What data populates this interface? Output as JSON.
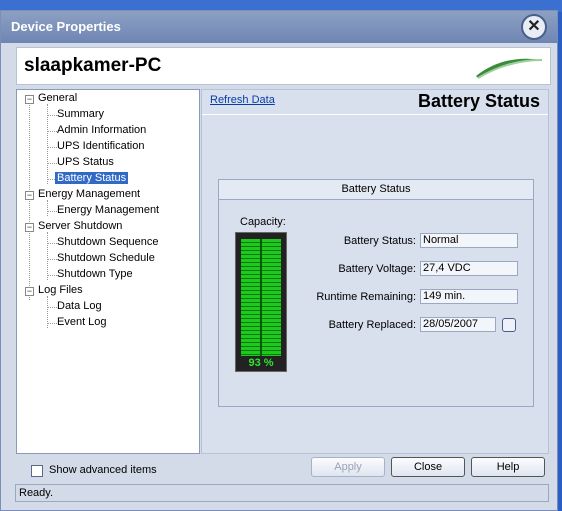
{
  "window": {
    "title": "Device Properties",
    "close_icon": "close-icon"
  },
  "header": {
    "hostname": "slaapkamer-PC",
    "logo_icon": "swoosh-logo-icon"
  },
  "tree": {
    "general": "General",
    "summary": "Summary",
    "admin_info": "Admin Information",
    "ups_id": "UPS Identification",
    "ups_status": "UPS Status",
    "battery_status": "Battery Status",
    "energy_mgmt_group": "Energy Management",
    "energy_mgmt": "Energy Management",
    "server_shutdown": "Server Shutdown",
    "shutdown_sequence": "Shutdown Sequence",
    "shutdown_schedule": "Shutdown Schedule",
    "shutdown_type": "Shutdown Type",
    "log_files": "Log Files",
    "data_log": "Data Log",
    "event_log": "Event Log",
    "expander_symbol": "−"
  },
  "content": {
    "refresh_link": "Refresh Data",
    "heading": "Battery Status",
    "group_title": "Battery Status",
    "capacity_label": "Capacity:",
    "capacity_value": "93 %",
    "capacity_fraction": 0.93,
    "fields": {
      "battery_status_label": "Battery Status:",
      "battery_status_value": "Normal",
      "battery_voltage_label": "Battery Voltage:",
      "battery_voltage_value": "27,4 VDC",
      "runtime_label": "Runtime Remaining:",
      "runtime_value": "149 min.",
      "replaced_label": "Battery Replaced:",
      "replaced_value": "28/05/2007"
    }
  },
  "footer": {
    "show_advanced": "Show advanced items",
    "apply": "Apply",
    "close": "Close",
    "help": "Help",
    "status": "Ready."
  },
  "colors": {
    "selection": "#316ac5",
    "meter_green": "#1ec81e",
    "link": "#0a3ca8"
  }
}
